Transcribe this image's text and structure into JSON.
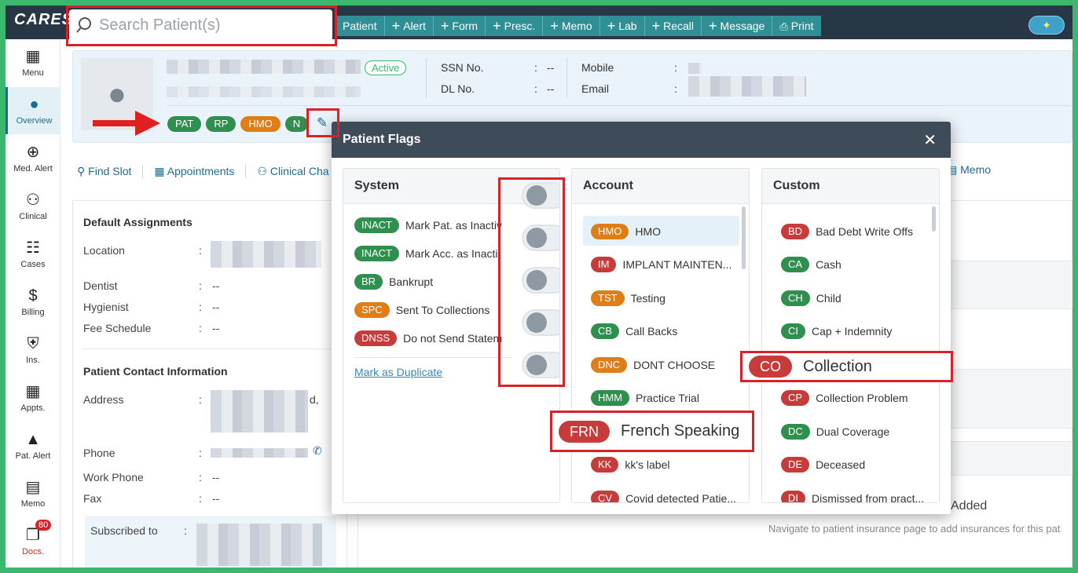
{
  "app": {
    "logo_text": "CARES",
    "brand_color": "#3bb86d"
  },
  "search": {
    "placeholder": "Search Patient(s)"
  },
  "actions": [
    "Patient",
    "Alert",
    "Form",
    "Presc.",
    "Memo",
    "Lab",
    "Recall",
    "Message",
    "Print"
  ],
  "sidebar": [
    {
      "label": "Menu",
      "icon": "grid-icon"
    },
    {
      "label": "Overview",
      "icon": "person-icon",
      "active": true
    },
    {
      "label": "Med. Alert",
      "icon": "plus-circle-icon"
    },
    {
      "label": "Clinical",
      "icon": "rx-icon"
    },
    {
      "label": "Cases",
      "icon": "clipboard-icon"
    },
    {
      "label": "Billing",
      "icon": "dollar-doc-icon"
    },
    {
      "label": "Ins.",
      "icon": "shield-icon"
    },
    {
      "label": "Appts.",
      "icon": "calendar-icon"
    },
    {
      "label": "Pat. Alert",
      "icon": "warning-icon"
    },
    {
      "label": "Memo",
      "icon": "note-icon"
    },
    {
      "label": "Docs.",
      "icon": "docs-icon",
      "badge": "80"
    }
  ],
  "patient": {
    "status": "Active",
    "ssn_label": "SSN No.",
    "ssn_value": "--",
    "dl_label": "DL No.",
    "dl_value": "--",
    "mobile_label": "Mobile",
    "email_label": "Email",
    "tags": [
      {
        "code": "PAT",
        "color": "#2f8f4e"
      },
      {
        "code": "RP",
        "color": "#2f8f4e"
      },
      {
        "code": "HMO",
        "color": "#e07d16"
      },
      {
        "code": "N",
        "color": "#2f8f4e"
      }
    ]
  },
  "sublinks": [
    "Find Slot",
    "Appointments",
    "Clinical Cha"
  ],
  "memo_link": "Memo",
  "assignments": {
    "title": "Default Assignments",
    "rows": [
      {
        "label": "Location",
        "value": ""
      },
      {
        "label": "Dentist",
        "value": "--"
      },
      {
        "label": "Hygienist",
        "value": "--"
      },
      {
        "label": "Fee Schedule",
        "value": "--"
      }
    ]
  },
  "contact": {
    "title": "Patient Contact Information",
    "address_label": "Address",
    "address_suffix": "d,",
    "phone_label": "Phone",
    "work_phone_label": "Work Phone",
    "work_phone_value": "--",
    "fax_label": "Fax",
    "fax_value": "--",
    "subscribed_label": "Subscribed to"
  },
  "insurance": {
    "added_text": "Added",
    "hint": "Navigate to patient insurance page to add insurances for this pat"
  },
  "modal": {
    "title": "Patient Flags",
    "system": {
      "title": "System",
      "flags": [
        {
          "code": "INACT",
          "label": "Mark Pat. as Inactiv",
          "color": "#2f8f4e"
        },
        {
          "code": "INACT",
          "label": "Mark Acc. as Inacti",
          "color": "#2f8f4e"
        },
        {
          "code": "BR",
          "label": "Bankrupt",
          "color": "#2f8f4e"
        },
        {
          "code": "SPC",
          "label": "Sent To Collections",
          "color": "#e07d16"
        },
        {
          "code": "DNSS",
          "label": "Do not Send Statem",
          "color": "#c83b3b"
        }
      ],
      "duplicate_link": "Mark as Duplicate"
    },
    "account": {
      "title": "Account",
      "flags": [
        {
          "code": "HMO",
          "label": "HMO",
          "color": "#e07d16",
          "selected": true
        },
        {
          "code": "IM",
          "label": "IMPLANT MAINTEN...",
          "color": "#c83b3b"
        },
        {
          "code": "TST",
          "label": "Testing",
          "color": "#e07d16"
        },
        {
          "code": "CB",
          "label": "Call Backs",
          "color": "#2f8f4e"
        },
        {
          "code": "DNC",
          "label": "DONT CHOOSE",
          "color": "#e07d16"
        },
        {
          "code": "HMM",
          "label": "Practice Trial",
          "color": "#2f8f4e"
        },
        {
          "code": "FRN",
          "label": "French Speaking",
          "color": "#c83b3b"
        },
        {
          "code": "KK",
          "label": "kk's label",
          "color": "#c83b3b"
        },
        {
          "code": "CV",
          "label": "Covid detected Patie...",
          "color": "#c83b3b"
        }
      ]
    },
    "custom": {
      "title": "Custom",
      "flags": [
        {
          "code": "BD",
          "label": "Bad Debt Write Offs",
          "color": "#c83b3b"
        },
        {
          "code": "CA",
          "label": "Cash",
          "color": "#2f8f4e"
        },
        {
          "code": "CH",
          "label": "Child",
          "color": "#2f8f4e"
        },
        {
          "code": "CI",
          "label": "Cap + Indemnity",
          "color": "#2f8f4e"
        },
        {
          "code": "CO",
          "label": "Collection",
          "color": "#c83b3b"
        },
        {
          "code": "CP",
          "label": "Collection Problem",
          "color": "#c83b3b"
        },
        {
          "code": "DC",
          "label": "Dual Coverage",
          "color": "#2f8f4e"
        },
        {
          "code": "DE",
          "label": "Deceased",
          "color": "#c83b3b"
        },
        {
          "code": "DI",
          "label": "Dismissed from pract...",
          "color": "#c83b3b"
        }
      ]
    }
  }
}
